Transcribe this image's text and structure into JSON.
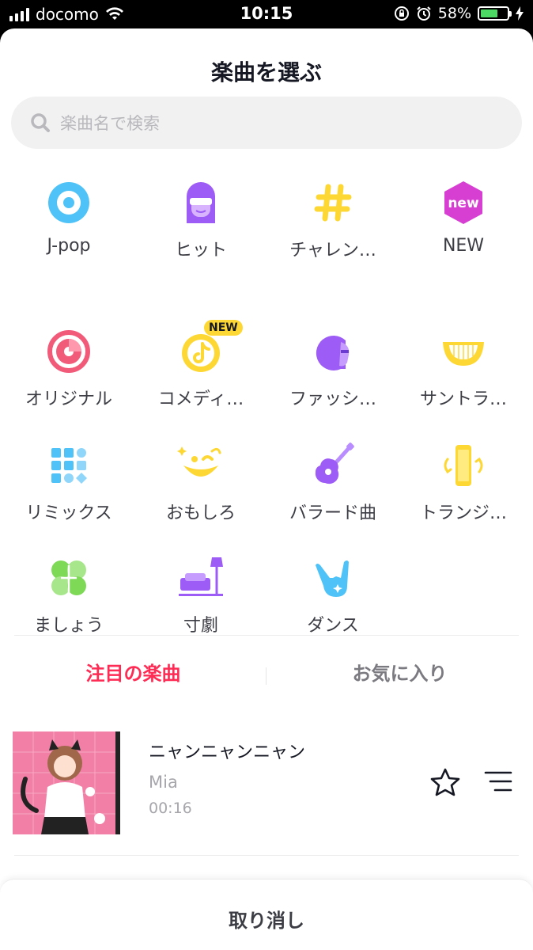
{
  "status_bar": {
    "carrier": "docomo",
    "time": "10:15",
    "battery": "58%",
    "battery_level": 0.58
  },
  "header": {
    "title": "楽曲を選ぶ"
  },
  "search": {
    "placeholder": "楽曲名で検索"
  },
  "categories": [
    {
      "label": "J-pop",
      "icon": "disc-icon"
    },
    {
      "label": "ヒット",
      "icon": "sunglasses-person-icon"
    },
    {
      "label": "チャレン…",
      "icon": "hashtag-icon"
    },
    {
      "label": "NEW",
      "icon": "new-hexagon-icon"
    },
    {
      "label": "オリジナル",
      "icon": "pink-record-icon"
    },
    {
      "label": "コメディ…",
      "icon": "tiktok-note-icon",
      "badge": "NEW"
    },
    {
      "label": "ファッシ…",
      "icon": "head-profile-icon"
    },
    {
      "label": "サントラ…",
      "icon": "smile-mouth-icon"
    },
    {
      "label": "リミックス",
      "icon": "grid-dots-icon"
    },
    {
      "label": "おもしろ",
      "icon": "wink-face-icon"
    },
    {
      "label": "バラード曲",
      "icon": "guitar-icon"
    },
    {
      "label": "トランジ…",
      "icon": "phone-rotate-icon"
    },
    {
      "label": "ましょう",
      "icon": "clover-icon"
    },
    {
      "label": "寸劇",
      "icon": "sofa-lamp-icon"
    },
    {
      "label": "ダンス",
      "icon": "rock-hand-icon"
    }
  ],
  "tabs": [
    {
      "label": "注目の楽曲",
      "active": true
    },
    {
      "label": "お気に入り",
      "active": false
    }
  ],
  "songs": [
    {
      "title": "ニャンニャンニャン",
      "artist": "Mia",
      "duration": "00:16"
    }
  ],
  "footer": {
    "cancel_label": "取り消し"
  },
  "colors": {
    "accent": "#fe2c55",
    "yellow": "#fdd835",
    "purple": "#9c5cf5",
    "blue": "#4fc3f7"
  }
}
